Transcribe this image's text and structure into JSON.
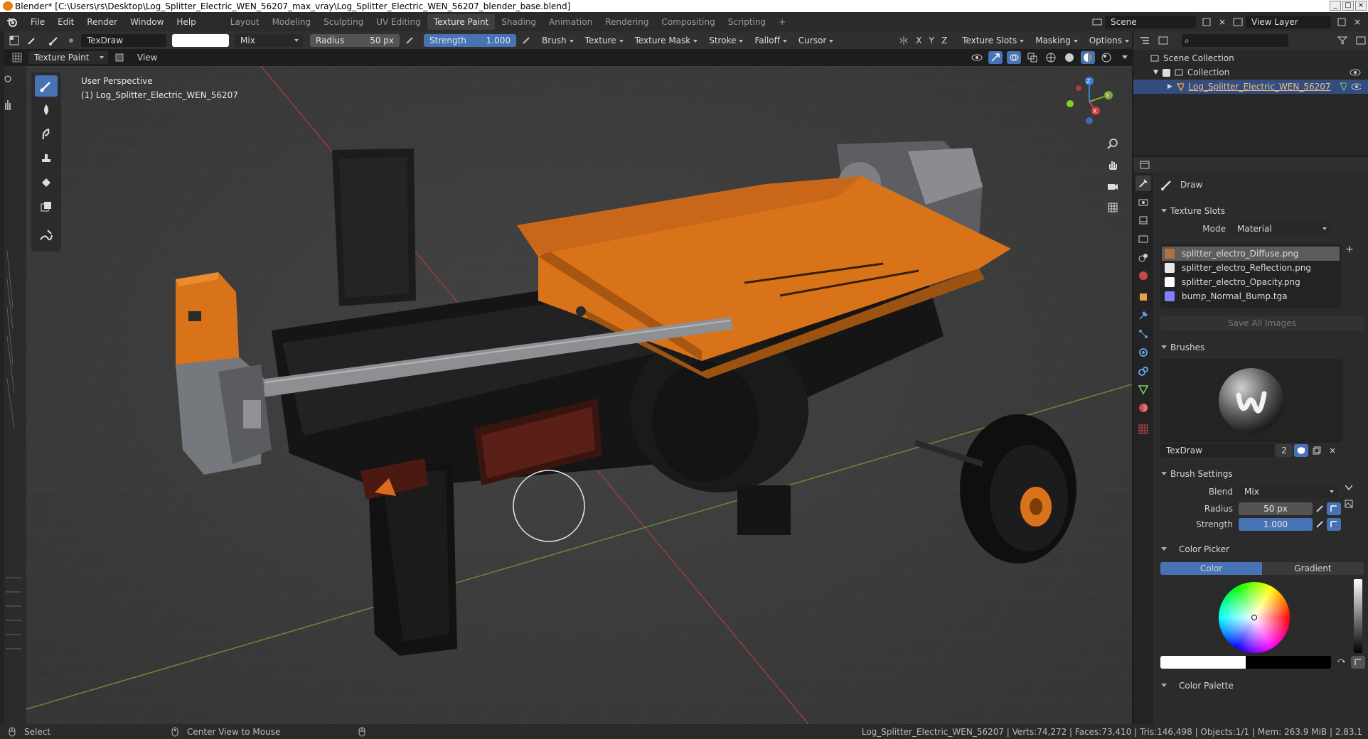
{
  "window": {
    "title": "Blender* [C:\\Users\\rs\\Desktop\\Log_Splitter_Electric_WEN_56207_max_vray\\Log_Splitter_Electric_WEN_56207_blender_base.blend]"
  },
  "menus": [
    "File",
    "Edit",
    "Render",
    "Window",
    "Help"
  ],
  "workspaces": [
    {
      "label": "Layout"
    },
    {
      "label": "Modeling"
    },
    {
      "label": "Sculpting"
    },
    {
      "label": "UV Editing"
    },
    {
      "label": "Texture Paint",
      "active": true
    },
    {
      "label": "Shading"
    },
    {
      "label": "Animation"
    },
    {
      "label": "Rendering"
    },
    {
      "label": "Compositing"
    },
    {
      "label": "Scripting"
    },
    {
      "label": "+"
    }
  ],
  "scene": {
    "name": "Scene",
    "view_layer": "View Layer"
  },
  "tool_header": {
    "brush_name": "TexDraw",
    "blend": "Mix",
    "radius_label": "Radius",
    "radius_value": "50 px",
    "strength_label": "Strength",
    "strength_value": "1.000",
    "menus": [
      "Brush",
      "Texture",
      "Texture Mask",
      "Stroke",
      "Falloff",
      "Cursor"
    ],
    "axes": [
      "X",
      "Y",
      "Z"
    ],
    "right_menus": [
      "Texture Slots",
      "Masking",
      "Options"
    ]
  },
  "viewport_header": {
    "mode": "Texture Paint",
    "view": "View"
  },
  "viewport": {
    "overlay_line1": "User Perspective",
    "overlay_line2": "(1) Log_Splitter_Electric_WEN_56207",
    "gizmo_axes": [
      "Z",
      "Y",
      "X"
    ]
  },
  "outliner": {
    "scene_collection": "Scene Collection",
    "collection": "Collection",
    "object": "Log_Splitter_Electric_WEN_56207"
  },
  "properties": {
    "tool_name": "Draw",
    "texture_slots": {
      "header": "Texture Slots",
      "mode_label": "Mode",
      "mode_value": "Material",
      "slots": [
        {
          "name": "splitter_electro_Diffuse.png",
          "color": "#b07040",
          "selected": true
        },
        {
          "name": "splitter_electro_Reflection.png",
          "color": "#e8e8e8"
        },
        {
          "name": "splitter_electro_Opacity.png",
          "color": "#ffffff"
        },
        {
          "name": "bump_Normal_Bump.tga",
          "color": "#8080ff"
        }
      ],
      "save_all": "Save All Images"
    },
    "brushes": {
      "header": "Brushes",
      "name": "TexDraw",
      "users": "2"
    },
    "brush_settings": {
      "header": "Brush Settings",
      "blend_label": "Blend",
      "blend_value": "Mix",
      "radius_label": "Radius",
      "radius_value": "50 px",
      "strength_label": "Strength",
      "strength_value": "1.000"
    },
    "color_picker": {
      "header": "Color Picker",
      "tab_color": "Color",
      "tab_gradient": "Gradient"
    },
    "color_palette": {
      "header": "Color Palette"
    }
  },
  "statusbar": {
    "select": "Select",
    "center_view": "Center View to Mouse",
    "stats": "Log_Splitter_Electric_WEN_56207 | Verts:74,272 | Faces:73,410 | Tris:146,498 | Objects:1/1 | Mem: 263.9 MiB | 2.83.1"
  },
  "colors": {
    "accent": "#4772b3",
    "orange": "#d9731a",
    "bg": "#303030"
  }
}
